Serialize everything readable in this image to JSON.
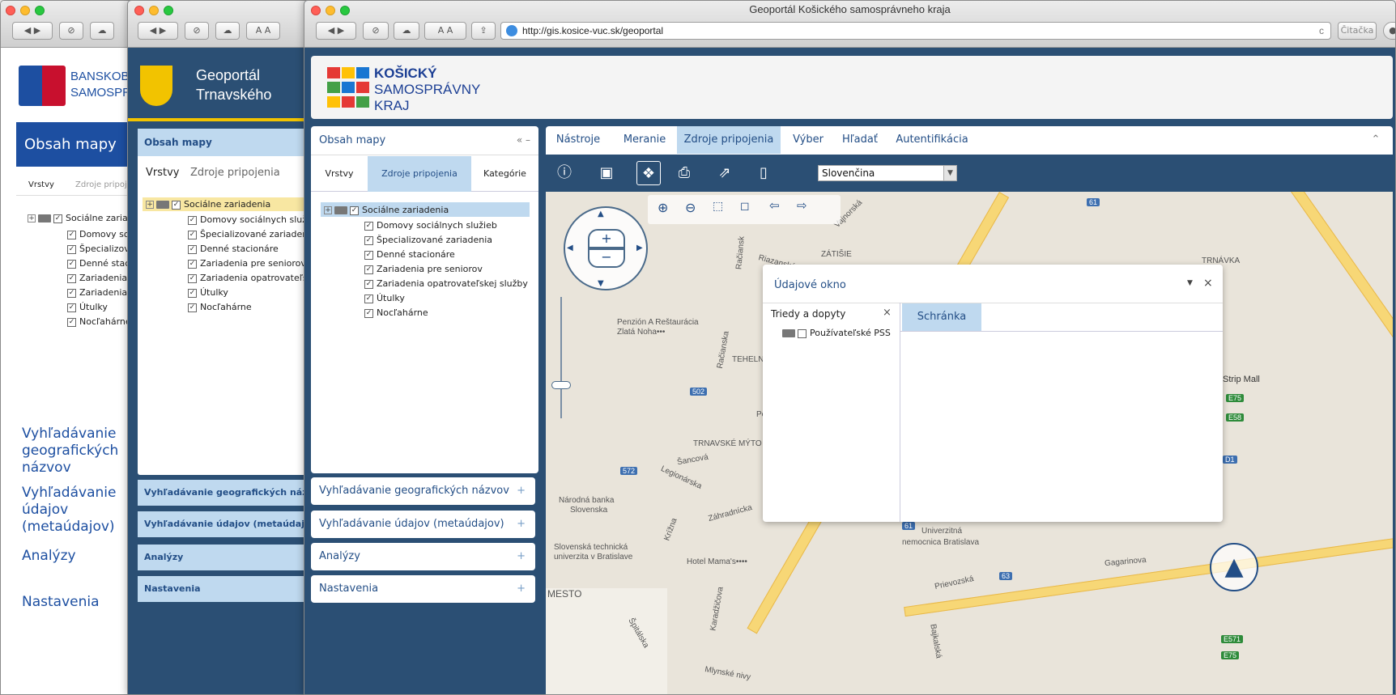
{
  "window1": {
    "header": "BANSKOBYSTRICKÝ SAMOSPRÁVNY KRAJ",
    "panel_title": "Obsah mapy",
    "tabs": [
      "Vrstvy",
      "Zdroje pripojenia"
    ],
    "layers": [
      "Sociálne zariadenia",
      "Domovy sociálnych služieb",
      "Špecializované zariadenia",
      "Denné stacionáre",
      "Zariadenia pre seniorov",
      "Zariadenia opatrovateľskej služby",
      "Útulky",
      "Nocľahárne"
    ],
    "sections": [
      "Vyhľadávanie geografických názvov",
      "Vyhľadávanie údajov (metaúdajov)",
      "Analýzy",
      "Nastavenia"
    ]
  },
  "window2": {
    "header": "Geoportál Trnavského samosprávneho kraja",
    "panel_title": "Obsah mapy",
    "tabs": [
      "Vrstvy",
      "Zdroje pripojenia"
    ],
    "layers": [
      "Sociálne zariadenia",
      "Domovy sociálnych služieb",
      "Špecializované zariadenia",
      "Denné stacionáre",
      "Zariadenia pre seniorov",
      "Zariadenia opatrovateľskej služby",
      "Útulky",
      "Nocľahárne"
    ],
    "sections": [
      "Vyhľadávanie geografických názvov",
      "Vyhľadávanie údajov (metaúdajov)",
      "Analýzy",
      "Nastavenia"
    ]
  },
  "window3": {
    "title": "Geoportál Košického samosprávneho kraja",
    "url": "http://gis.kosice-vuc.sk/geoportal",
    "reader": "Čitačka",
    "logo": [
      "KOŠICKÝ",
      "SAMOSPRÁVNY",
      "KRAJ"
    ],
    "panel_title": "Obsah mapy",
    "panel_controls": "«  –",
    "tabs": [
      "Vrstvy",
      "Zdroje pripojenia",
      "Kategórie"
    ],
    "layers": [
      "Sociálne zariadenia",
      "Domovy sociálnych služieb",
      "Špecializované zariadenia",
      "Denné stacionáre",
      "Zariadenia pre seniorov",
      "Zariadenia opatrovateľskej služby",
      "Útulky",
      "Nocľahárne"
    ],
    "sections": [
      "Vyhľadávanie geografických názvov",
      "Vyhľadávanie údajov (metaúdajov)",
      "Analýzy",
      "Nastavenia"
    ],
    "section_icon": "+",
    "toolbar_tabs": [
      "Nástroje",
      "Meranie",
      "Zdroje pripojenia",
      "Výber",
      "Hľadať",
      "Autentifikácia"
    ],
    "language": "Slovenčina",
    "tool_icons": [
      "info-icon",
      "window-icon",
      "dropbox-icon",
      "print-icon",
      "share-icon",
      "clipboard-icon"
    ],
    "data_window": {
      "title": "Údajové okno",
      "left_title": "Triedy a dopyty",
      "tab": "Schránka",
      "item": "Používateľské PSS"
    },
    "map_labels": [
      "Vajnorská",
      "Riazanská",
      "ZÁTIŠIE",
      "TRNÁVKA",
      "Penzión A Reštaurácia",
      "Zlatá Noha•••",
      "Račianska",
      "TEHELNÉ",
      "Policl",
      "TRNAVSKÉ MÝTO",
      "Šancová",
      "Legionárska",
      "Národná banka",
      "Slovenska",
      "Krížna",
      "Záhradnícka",
      "Slovenská technická",
      "univerzita v Bratislave",
      "Hotel Mama's••••",
      "Univerzitná",
      "nemocnica Bratislava",
      "Prievozská",
      "Gagarinova",
      "Strip Mall",
      "Mlynské nivy",
      "Karadžičova",
      "Špitálska",
      "MESTO",
      "Bajkalská",
      "Račiansk"
    ],
    "shields": [
      "61",
      "502",
      "572",
      "63",
      "61",
      "D1",
      "E75",
      "E58",
      "E571",
      "E75"
    ]
  }
}
